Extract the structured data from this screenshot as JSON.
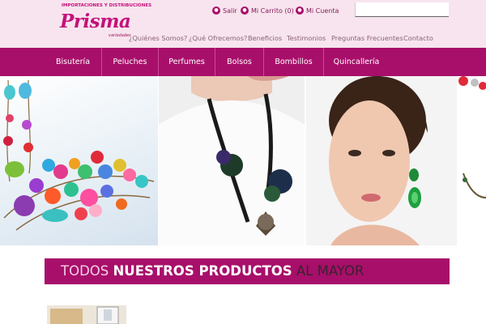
{
  "logo": {
    "top_text": "IMPORTACIONES Y DISTRIBUCIONES",
    "name": "Prisma",
    "sub_text": "variedades"
  },
  "utility": {
    "salir": "Salir",
    "carrito": "Mi Carrito (0)",
    "cuenta": "Mi Cuenta"
  },
  "search": {
    "placeholder": "",
    "value": ""
  },
  "top_nav": [
    "¿Quiénes Somos?",
    "¿Qué Ofrecemos?",
    "Beneficios",
    "Testimonios",
    "Preguntas Frecuentes",
    "Contacto"
  ],
  "main_nav": [
    "Bisutería",
    "Peluches",
    "Perfumes",
    "Bolsos",
    "Bombillos",
    "Quincallería"
  ],
  "products_title": {
    "part1": "TODOS",
    "part2": "NUESTROS PRODUCTOS",
    "part3": "AL MAYOR"
  },
  "colors": {
    "brand": "#a80f6a",
    "header_bg": "#f7e4ee",
    "logo": "#c4117b"
  },
  "icons": {
    "salir": "user-icon",
    "carrito": "cart-icon",
    "cuenta": "user-icon"
  }
}
